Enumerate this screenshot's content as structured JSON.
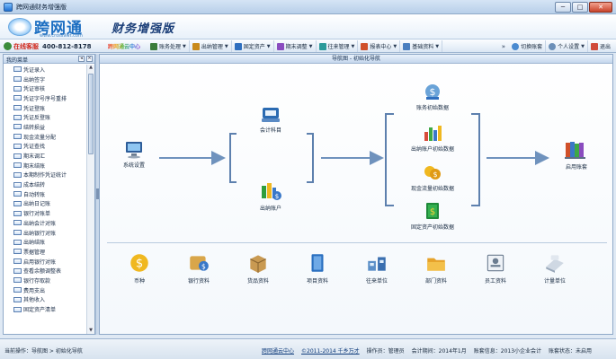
{
  "window": {
    "title": "跨网通财务增强版",
    "minimize": "─",
    "maximize": "□",
    "close": "✕"
  },
  "banner": {
    "logo": "跨网通",
    "logo_sub": "www.cross9wt.com",
    "edition": "财务增强版"
  },
  "toolbar": {
    "support_label": "在线客服",
    "phone": "400-812-8178",
    "cloud_label": "跨网通云中心",
    "items": [
      {
        "label": "账务处理",
        "icon": "ledger-icon",
        "color": "#3b7d3b"
      },
      {
        "label": "出纳管理",
        "icon": "cashier-icon",
        "color": "#c98a1b"
      },
      {
        "label": "固定资产",
        "icon": "asset-icon",
        "color": "#2f6fbf"
      },
      {
        "label": "期末调整",
        "icon": "period-icon",
        "color": "#8a4cbf"
      },
      {
        "label": "往来管理",
        "icon": "contact-icon",
        "color": "#2b9a9a"
      },
      {
        "label": "报表中心",
        "icon": "report-icon",
        "color": "#d0502a"
      },
      {
        "label": "基础资料",
        "icon": "basedata-icon",
        "color": "#4a7fc0"
      }
    ],
    "more": "»",
    "switch_label": "切换账套",
    "personal_label": "个人设置",
    "exit_label": "退出"
  },
  "left_panel": {
    "title": "我的菜单",
    "items": [
      "凭证录入",
      "出纳签字",
      "凭证审核",
      "凭证字号序号重排",
      "凭证登账",
      "凭证反登账",
      "结转损益",
      "现金流量分配",
      "凭证查找",
      "期末调汇",
      "期末结账",
      "本期制作凭证统计",
      "成本结转",
      "自动转账",
      "出纳日记账",
      "银行对账单",
      "出纳会计对账",
      "出纳银行对账",
      "出纳结账",
      "票据管理",
      "启用银行对账",
      "查看余额调整表",
      "银行存取款",
      "费用支出",
      "其他收入",
      "固定资产清单"
    ]
  },
  "main_panel": {
    "title": "导航图 - 初始化导航",
    "flow": {
      "system": "系统设置",
      "accounts": "会计科目",
      "cash_accounts": "出纳账户",
      "init_ledger": "账务初始数据",
      "init_cashier": "出纳账户初始数据",
      "init_cashflow": "现金流量初始数据",
      "init_assets": "固定资产初始数据",
      "enable": "启用账套"
    },
    "bottom": [
      "币种",
      "银行资料",
      "货品资料",
      "项目资料",
      "往来单位",
      "部门资料",
      "员工资料",
      "计量单位"
    ]
  },
  "status": {
    "current_op_label": "当前操作：",
    "current_op": "导航图 > 初始化导航",
    "cloud": "跨网通云中心",
    "copyright": "©2011-2014 千乡万才",
    "operator": "操作员：管理员",
    "period": "会计期间：2014年1月",
    "info": "账套信息：2013小企业会计",
    "state": "账套状态：未启用"
  },
  "colors": {
    "accent": "#1d6fc2",
    "arrow": "#6f92bd",
    "bracket": "#5d80ae"
  }
}
